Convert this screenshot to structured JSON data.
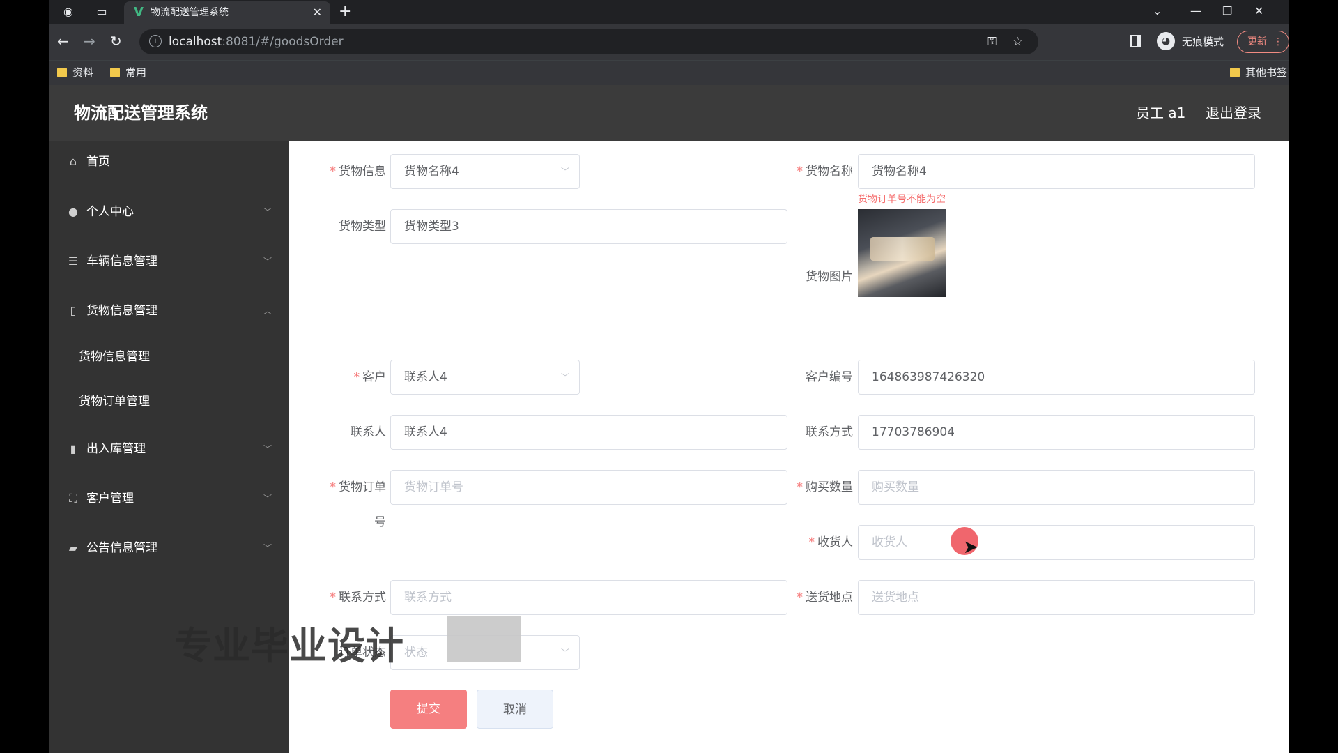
{
  "browser": {
    "tab_title": "物流配送管理系统",
    "tab_favicon": "V",
    "tab_close": "✕",
    "new_tab": "+",
    "url_host": "localhost",
    "url_rest": ":8081/#/goodsOrder",
    "incognito_label": "无痕模式",
    "update_label": "更新",
    "bookmarks": [
      "资料",
      "常用"
    ],
    "other_bookmarks": "其他书签"
  },
  "app": {
    "title": "物流配送管理系统",
    "user": "员工 a1",
    "logout": "退出登录"
  },
  "sidebar": {
    "items": [
      {
        "label": "首页",
        "icon": "home-icon"
      },
      {
        "label": "个人中心",
        "icon": "user-icon"
      },
      {
        "label": "车辆信息管理",
        "icon": "sliders-icon"
      },
      {
        "label": "货物信息管理",
        "icon": "phone-icon"
      },
      {
        "label": "出入库管理",
        "icon": "bar-chart-icon"
      },
      {
        "label": "客户管理",
        "icon": "fullscreen-icon"
      },
      {
        "label": "公告信息管理",
        "icon": "briefcase-icon"
      }
    ],
    "subitems": [
      "货物信息管理",
      "货物订单管理"
    ]
  },
  "form": {
    "goods_info": {
      "label": "货物信息",
      "value": "货物名称4"
    },
    "goods_name": {
      "label": "货物名称",
      "value": "货物名称4"
    },
    "error_msg": "货物订单号不能为空",
    "goods_type": {
      "label": "货物类型",
      "value": "货物类型3"
    },
    "goods_image": {
      "label": "货物图片"
    },
    "customer": {
      "label": "客户",
      "value": "联系人4"
    },
    "customer_no": {
      "label": "客户编号",
      "value": "164863987426320"
    },
    "contact": {
      "label": "联系人",
      "value": "联系人4"
    },
    "contact_phone": {
      "label": "联系方式",
      "value": "17703786904"
    },
    "order_no": {
      "label_line1": "货物订单",
      "label_line2": "号",
      "placeholder": "货物订单号"
    },
    "quantity": {
      "label": "购买数量",
      "placeholder": "购买数量"
    },
    "receiver": {
      "label": "收货人",
      "placeholder": "收货人"
    },
    "receiver_phone": {
      "label": "联系方式",
      "placeholder": "联系方式"
    },
    "address": {
      "label": "送货地点",
      "placeholder": "送货地点"
    },
    "status": {
      "label": "订单状态",
      "placeholder": "状态"
    },
    "submit": "提交",
    "cancel": "取消"
  },
  "overlay": {
    "watermark": "专业毕业设计"
  }
}
